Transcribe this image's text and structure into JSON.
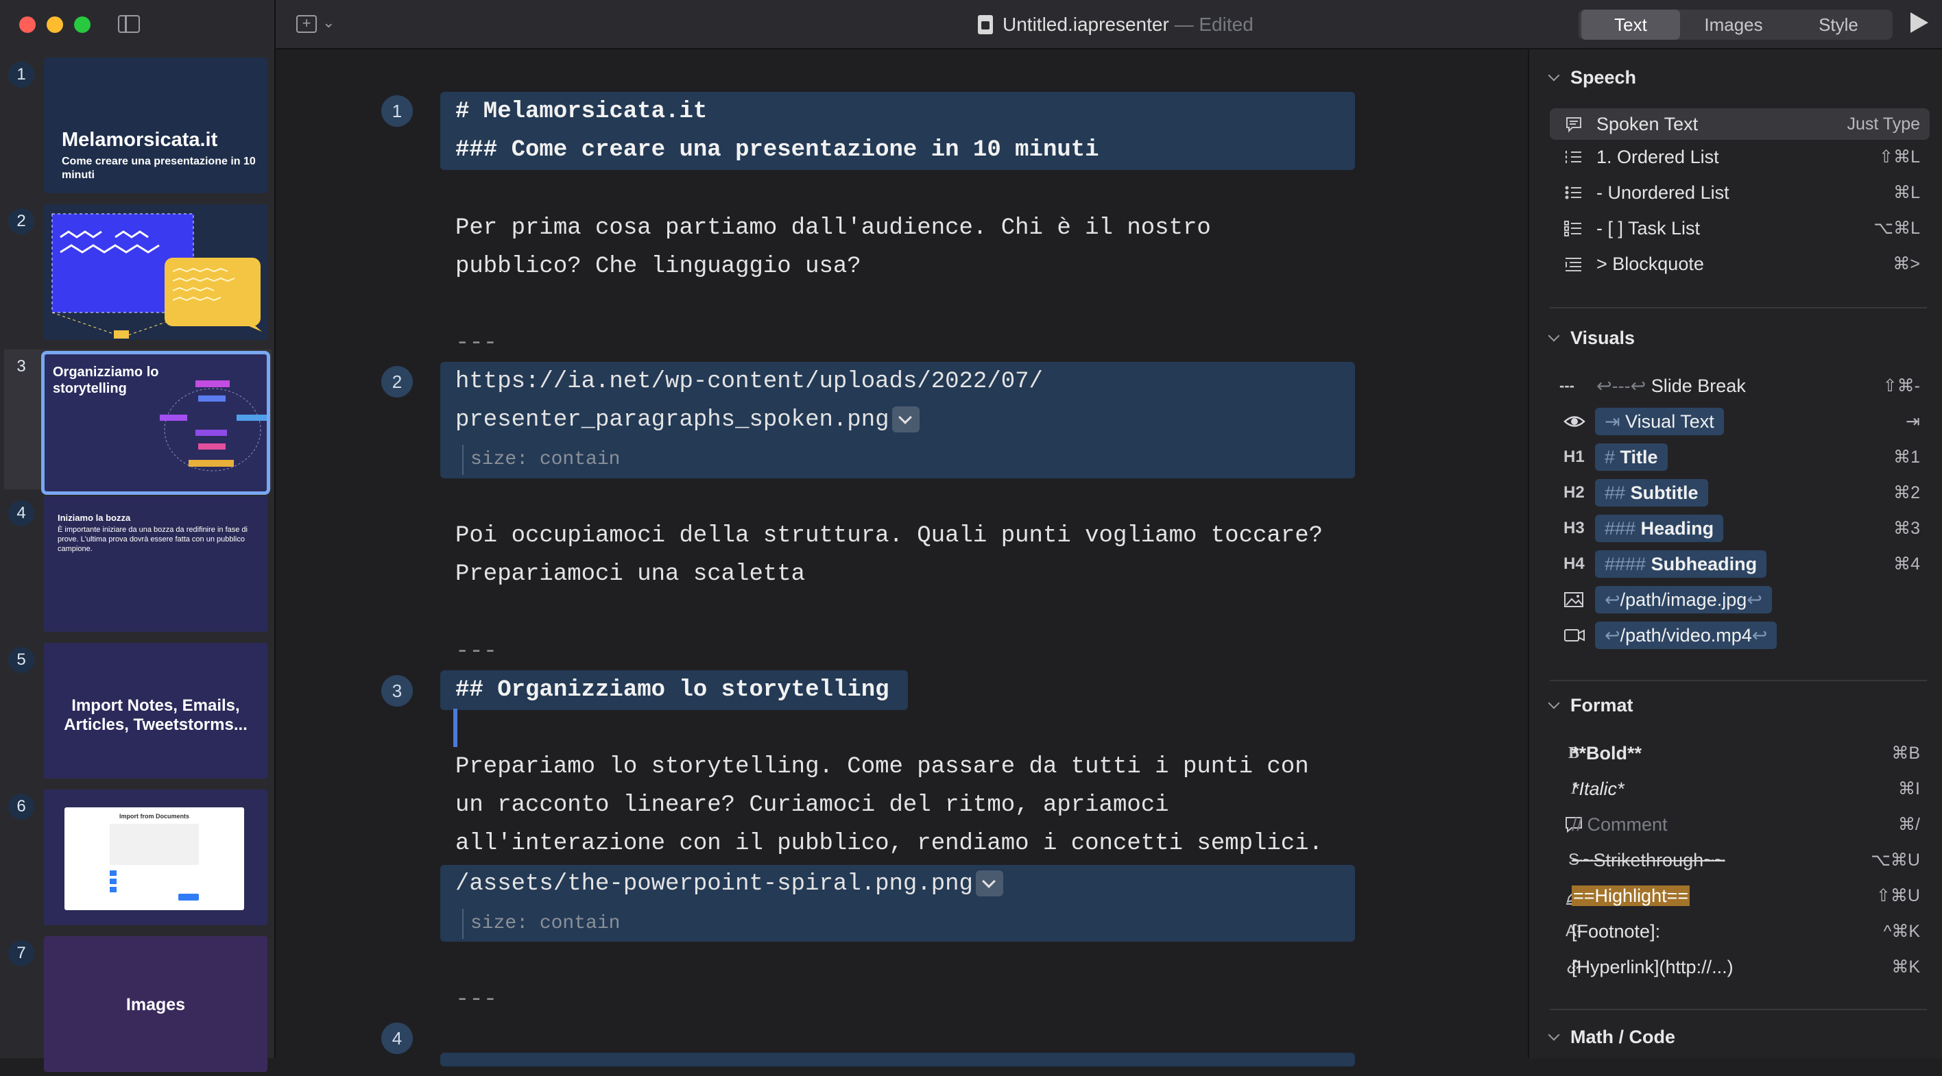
{
  "window": {
    "doc_title": "Untitled.iapresenter",
    "doc_status": "— Edited"
  },
  "toolbar": {
    "tabs": [
      {
        "label": "Text",
        "active": true
      },
      {
        "label": "Images",
        "active": false
      },
      {
        "label": "Style",
        "active": false
      }
    ]
  },
  "sidebar": {
    "slides": [
      {
        "number": "1",
        "title": "Melamorsicata.it",
        "subtitle": "Come creare una presentazione in 10 minuti"
      },
      {
        "number": "2"
      },
      {
        "number": "3",
        "title": "Organizziamo lo storytelling"
      },
      {
        "number": "4",
        "title": "Iniziamo la bozza",
        "subtitle": "È importante iniziare da una bozza da redifinire in fase di prove. L'ultima prova dovrà essere fatta con un pubblico campione."
      },
      {
        "number": "5",
        "title": "Import Notes, Emails, Articles, Tweetstorms..."
      },
      {
        "number": "6",
        "title": "Import from Documents"
      },
      {
        "number": "7",
        "title": "Images"
      }
    ]
  },
  "editor": {
    "markers": [
      "1",
      "2",
      "3",
      "4"
    ],
    "lines": {
      "l1": "# Melamorsicata.it",
      "l2": "### Come creare una presentazione in 10 minuti",
      "l3": "Per prima cosa partiamo dall'audience. Chi è il nostro",
      "l4": "pubblico? Che linguaggio usa?",
      "sep1": "---",
      "l5": "https://ia.net/wp-content/uploads/2022/07/",
      "l6": "presenter_paragraphs_spoken.png",
      "size1": "size: contain",
      "l7": "Poi occupiamoci della struttura. Quali punti vogliamo toccare?",
      "l8": "Prepariamoci una scaletta",
      "sep2": "---",
      "l9": "## Organizziamo lo storytelling",
      "l10": "Prepariamo lo storytelling. Come passare da tutti i punti con",
      "l11": "un racconto lineare? Curiamoci del ritmo, apriamoci",
      "l12": "all'interazione con il pubblico, rendiamo i concetti semplici.",
      "l13": "/assets/the-powerpoint-spiral.png.png",
      "size2": "size: contain",
      "sep3": "---"
    }
  },
  "panel": {
    "speech": {
      "heading": "Speech",
      "items": [
        {
          "label": "Spoken Text",
          "shortcut": "Just Type"
        },
        {
          "label": "1. Ordered List",
          "shortcut": "⇧⌘L"
        },
        {
          "label": "- Unordered List",
          "shortcut": "⌘L"
        },
        {
          "label": "- [ ] Task List",
          "shortcut": "⌥⌘L"
        },
        {
          "label": "> Blockquote",
          "shortcut": "⌘>"
        }
      ]
    },
    "visuals": {
      "heading": "Visuals",
      "items": [
        {
          "icon": "---",
          "label": "Slide Break",
          "shortcut": "⇧⌘-"
        },
        {
          "label": "Visual Text",
          "shortcut": "⇥"
        },
        {
          "icon": "H1",
          "prefix": "#",
          "label": "Title",
          "shortcut": "⌘1"
        },
        {
          "icon": "H2",
          "prefix": "##",
          "label": "Subtitle",
          "shortcut": "⌘2"
        },
        {
          "icon": "H3",
          "prefix": "###",
          "label": "Heading",
          "shortcut": "⌘3"
        },
        {
          "icon": "H4",
          "prefix": "####",
          "label": "Subheading",
          "shortcut": "⌘4"
        },
        {
          "label": "/path/image.jpg"
        },
        {
          "label": "/path/video.mp4"
        }
      ]
    },
    "format": {
      "heading": "Format",
      "items": [
        {
          "icon": "B",
          "label": "**Bold**",
          "shortcut": "⌘B"
        },
        {
          "icon": "I",
          "label": "*Italic*",
          "shortcut": "⌘I"
        },
        {
          "label": "// Comment",
          "shortcut": "⌘/"
        },
        {
          "icon": "S",
          "label": "~~Strikethrough~~",
          "shortcut": "⌥⌘U"
        },
        {
          "label": "==Highlight==",
          "shortcut": "⇧⌘U"
        },
        {
          "icon": "A¹",
          "label": "[Footnote]:",
          "shortcut": "^⌘K"
        },
        {
          "label": "[Hyperlink](http://...)",
          "shortcut": "⌘K"
        }
      ]
    },
    "math": {
      "heading": "Math / Code"
    }
  }
}
